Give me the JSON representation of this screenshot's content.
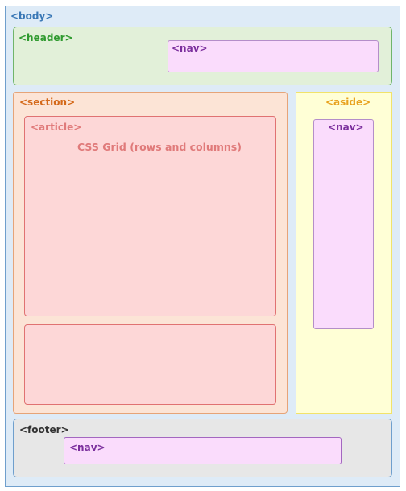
{
  "labels": {
    "body": "<body>",
    "header": "<header>",
    "header_nav": "<nav>",
    "section": "<section>",
    "article": "<article>",
    "article_text": "CSS Grid (rows and columns)",
    "aside": "<aside>",
    "aside_nav": "<nav>",
    "footer": "<footer>",
    "footer_nav": "<nav>"
  },
  "colors": {
    "body_fill": "#deebf7",
    "header_fill": "#e2f0d9",
    "section_fill": "#fce4d6",
    "article_fill": "#fdd7d7",
    "aside_fill": "#ffffd6",
    "nav_fill": "#fadcfc",
    "footer_fill": "#e7e7e7"
  }
}
